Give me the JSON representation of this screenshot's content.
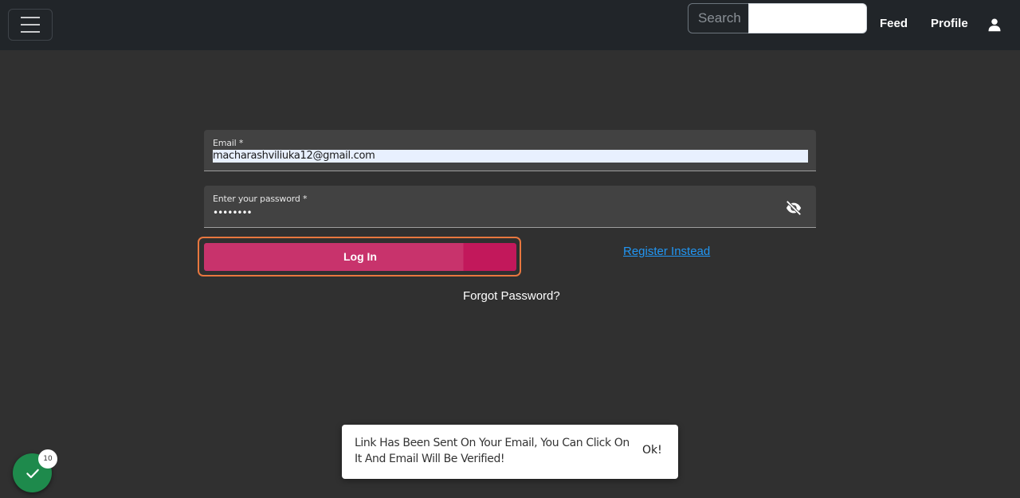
{
  "navbar": {
    "search_label": "Search",
    "search_value": "",
    "feed_label": "Feed",
    "profile_label": "Profile"
  },
  "login_form": {
    "email_label": "Email *",
    "email_value": "macharashviliuka12@gmail.com",
    "password_label": "Enter your password *",
    "password_value": "••••••••",
    "login_button_label": "Log In",
    "register_link_label": "Register Instead",
    "forgot_password_label": "Forgot Password?"
  },
  "toast": {
    "message": "Link Has Been Sent On Your Email, You Can Click On It And Email Will Be Verified!",
    "ok_label": "Ok!"
  },
  "status_widget": {
    "badge_count": "10"
  },
  "colors": {
    "background": "#303030",
    "navbar": "#212529",
    "login_button": "#c8336c",
    "focus_ring": "#e8773f",
    "link": "#2196f3",
    "status_fab": "#1e8a4c"
  },
  "icons": {
    "menu": "hamburger-icon",
    "user": "user-icon",
    "password_toggle": "eye-off-icon",
    "status": "checkmark-icon"
  }
}
